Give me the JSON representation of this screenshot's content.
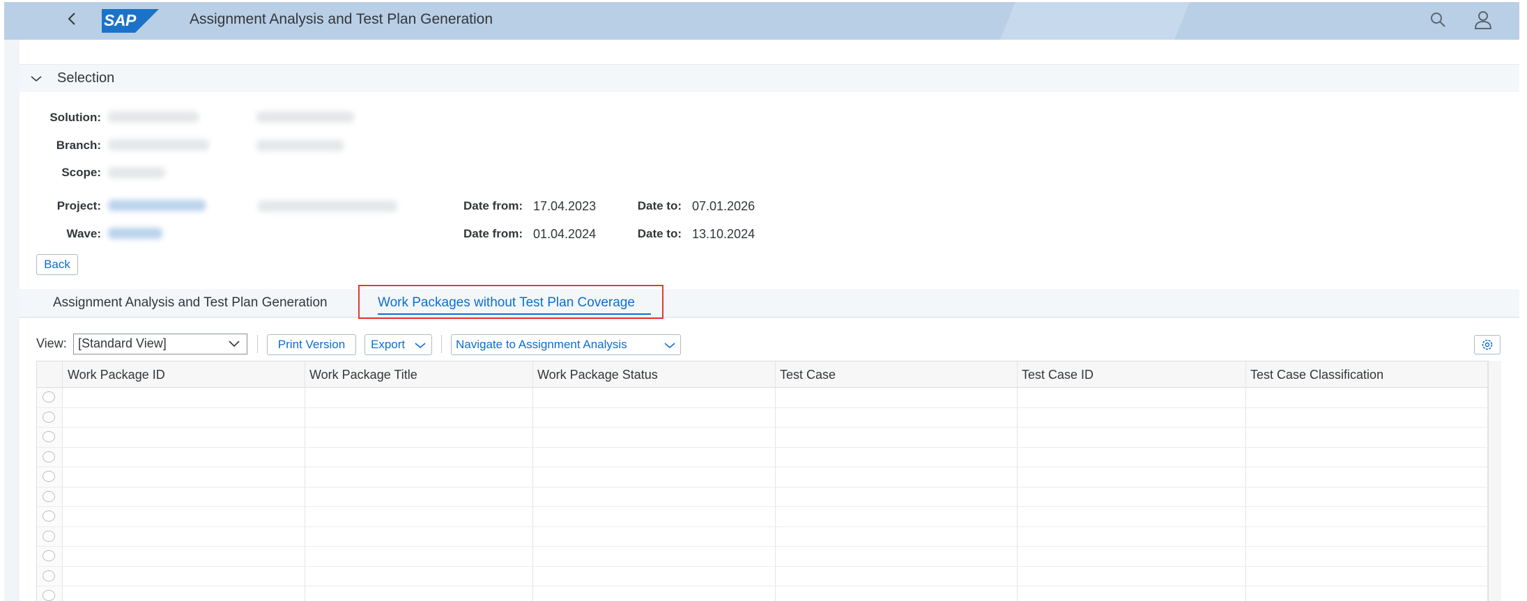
{
  "shell": {
    "title": "Assignment Analysis and Test Plan Generation",
    "logo": "SAP",
    "icons": {
      "back": "chevron-left-icon",
      "search": "search-icon",
      "user": "user-icon"
    }
  },
  "selection": {
    "title": "Selection",
    "fields": {
      "solution": "Solution:",
      "branch": "Branch:",
      "scope": "Scope:",
      "project": "Project:",
      "wave": "Wave:"
    },
    "project_dates": {
      "from_label": "Date from:",
      "from_value": "17.04.2023",
      "to_label": "Date to:",
      "to_value": "07.01.2026"
    },
    "wave_dates": {
      "from_label": "Date from:",
      "from_value": "01.04.2024",
      "to_label": "Date to:",
      "to_value": "13.10.2024"
    },
    "back_button": "Back"
  },
  "tabs": [
    {
      "label": "Assignment Analysis and Test Plan Generation",
      "active": false
    },
    {
      "label": "Work Packages without Test Plan Coverage",
      "active": true
    }
  ],
  "toolbar": {
    "view_label": "View:",
    "view_value": "[Standard View]",
    "print": "Print Version",
    "export": "Export",
    "navigate": "Navigate to Assignment Analysis"
  },
  "table": {
    "columns": [
      "Work Package ID",
      "Work Package Title",
      "Work Package Status",
      "Test Case",
      "Test Case ID",
      "Test Case Classification"
    ],
    "empty_rows": 11
  },
  "colors": {
    "shell_bg": "#b9cfe6",
    "accent": "#0a6ed1",
    "highlight": "#e53935"
  }
}
